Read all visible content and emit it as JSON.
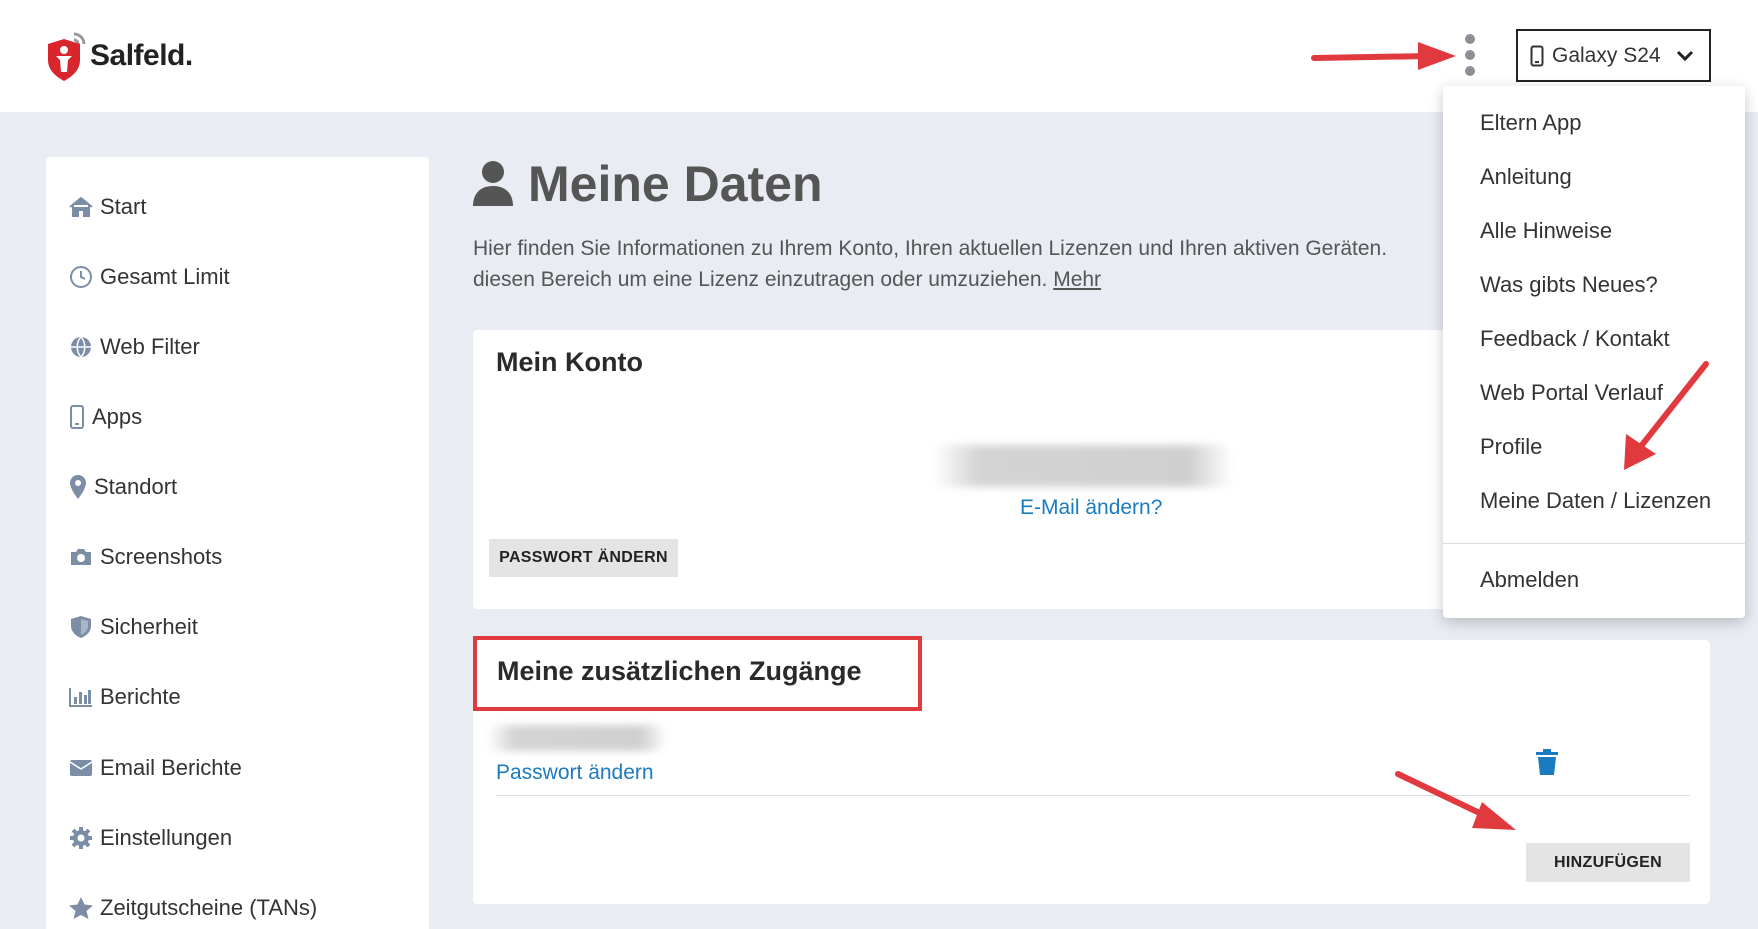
{
  "header": {
    "brand": "Salfeld.",
    "device_label": "Galaxy S24"
  },
  "sidebar": {
    "items": [
      {
        "label": "Start",
        "icon": "home-icon"
      },
      {
        "label": "Gesamt Limit",
        "icon": "clock-icon"
      },
      {
        "label": "Web Filter",
        "icon": "globe-icon"
      },
      {
        "label": "Apps",
        "icon": "phone-icon"
      },
      {
        "label": "Standort",
        "icon": "location-pin-icon"
      },
      {
        "label": "Screenshots",
        "icon": "camera-icon"
      },
      {
        "label": "Sicherheit",
        "icon": "shield-icon"
      },
      {
        "label": "Berichte",
        "icon": "bar-chart-icon"
      },
      {
        "label": "Email Berichte",
        "icon": "envelope-icon"
      },
      {
        "label": "Einstellungen",
        "icon": "gear-icon"
      },
      {
        "label": "Zeitgutscheine (TANs)",
        "icon": "star-icon"
      }
    ]
  },
  "main": {
    "title": "Meine Daten",
    "intro_line1": "Hier finden Sie Informationen zu Ihrem Konto, Ihren aktuellen Lizenzen und Ihren aktiven Geräten.",
    "intro_line2": "diesen Bereich um eine Lizenz einzutragen oder umzuziehen.",
    "more_link": "Mehr"
  },
  "account_card": {
    "title": "Mein Konto",
    "change_email_link": "E-Mail ändern?",
    "change_password_button": "PASSWORT ÄNDERN"
  },
  "access_card": {
    "title": "Meine zusätzlichen Zugänge",
    "change_password_link": "Passwort ändern",
    "add_button": "HINZUFÜGEN"
  },
  "dropdown": {
    "items": [
      "Eltern App",
      "Anleitung",
      "Alle Hinweise",
      "Was gibts Neues?",
      "Feedback / Kontakt",
      "Web Portal Verlauf",
      "Profile",
      "Meine Daten / Lizenzen"
    ],
    "logout": "Abmelden"
  },
  "colors": {
    "accent_link": "#1a7bc0",
    "highlight": "#e13a3e",
    "brand_red": "#d9262c",
    "delete_icon": "#1a7bc0"
  }
}
